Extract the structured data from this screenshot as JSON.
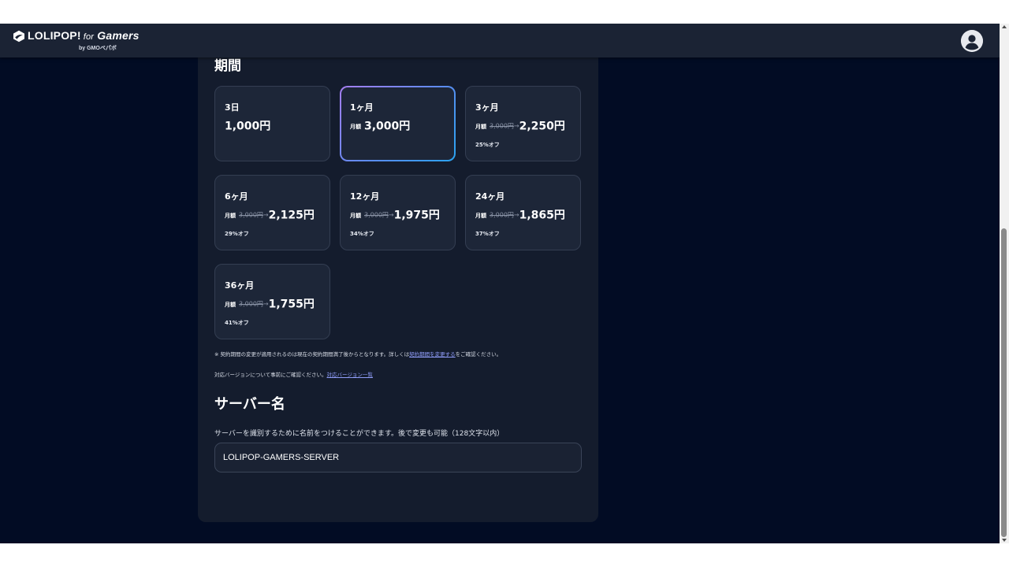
{
  "header": {
    "logo_main": "LOLIPOP!",
    "logo_for": "for",
    "logo_gamers": "Gamers",
    "logo_sub": "by GMOペパボ",
    "avatar_icon": "user-circle-icon"
  },
  "period": {
    "title": "期間",
    "plans": [
      {
        "term": "3日",
        "monthly": "",
        "original": "",
        "arrow": "",
        "price": "1,000円",
        "discount": ""
      },
      {
        "term": "1ヶ月",
        "monthly": "月額",
        "original": "",
        "arrow": "",
        "price": "3,000円",
        "discount": ""
      },
      {
        "term": "3ヶ月",
        "monthly": "月額",
        "original": "3,000円",
        "arrow": "→",
        "price": "2,250円",
        "discount": "25%オフ"
      },
      {
        "term": "6ヶ月",
        "monthly": "月額",
        "original": "3,000円",
        "arrow": "→",
        "price": "2,125円",
        "discount": "29%オフ"
      },
      {
        "term": "12ヶ月",
        "monthly": "月額",
        "original": "3,000円",
        "arrow": "→",
        "price": "1,975円",
        "discount": "34%オフ"
      },
      {
        "term": "24ヶ月",
        "monthly": "月額",
        "original": "3,000円",
        "arrow": "→",
        "price": "1,865円",
        "discount": "37%オフ"
      },
      {
        "term": "36ヶ月",
        "monthly": "月額",
        "original": "3,000円",
        "arrow": "→",
        "price": "1,755円",
        "discount": "41%オフ"
      }
    ],
    "selected_term": "1ヶ月",
    "note1_text": "※ 契約期間の変更が適用されるのは現在の契約期間満了後からとなります。詳しくは",
    "note1_link": "契約期間を変更する",
    "note1_suffix": "をご確認ください。",
    "note2_text": "対応バージョンについて事前にご確認ください。",
    "note2_link": "対応バージョン一覧"
  },
  "server_name": {
    "title": "サーバー名",
    "description": "サーバーを識別するために名前をつけることができます。後で変更も可能（128文字以内）",
    "value": "LOLIPOP-GAMERS-SERVER"
  },
  "colors": {
    "page_bg": "#020c24",
    "panel_bg": "#141c2d",
    "card_bg": "#1d2638",
    "header_bg": "#1b2334",
    "selected_gradient_start": "#a67ef0",
    "selected_gradient_end": "#2aa3f0",
    "link": "#8f9cf7"
  }
}
